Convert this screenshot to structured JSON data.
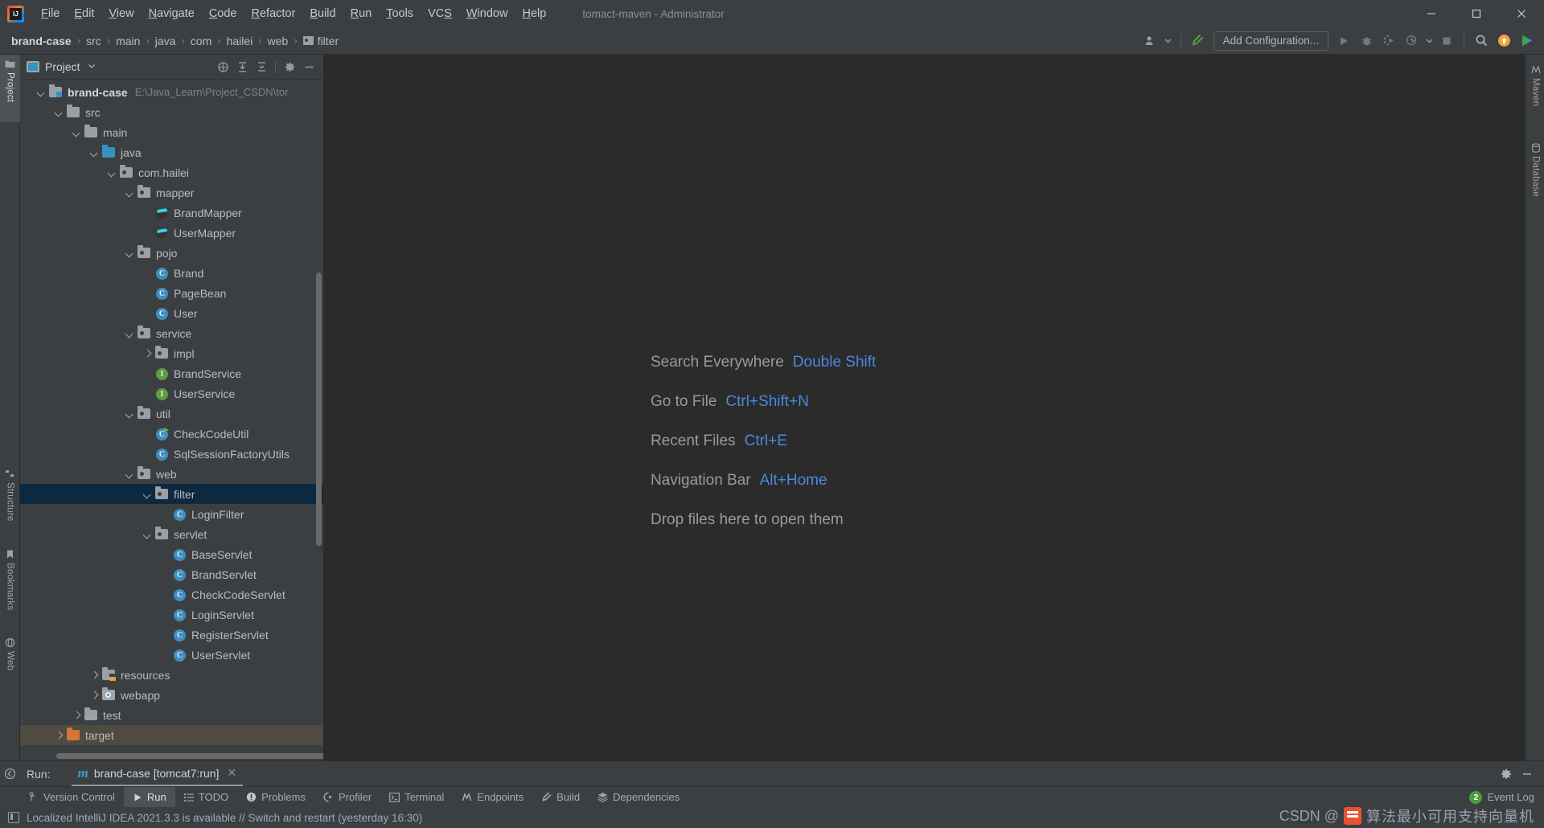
{
  "window": {
    "title": "tomact-maven - Administrator",
    "app_icon": "intellij-idea-logo",
    "controls": {
      "minimize": "─",
      "maximize": "❑",
      "close": "✕"
    }
  },
  "menubar": {
    "items": [
      {
        "label": "File",
        "mnemonic": "F"
      },
      {
        "label": "Edit",
        "mnemonic": "E"
      },
      {
        "label": "View",
        "mnemonic": "V"
      },
      {
        "label": "Navigate",
        "mnemonic": "N"
      },
      {
        "label": "Code",
        "mnemonic": "C"
      },
      {
        "label": "Refactor",
        "mnemonic": "R"
      },
      {
        "label": "Build",
        "mnemonic": "B"
      },
      {
        "label": "Run",
        "mnemonic": "R"
      },
      {
        "label": "Tools",
        "mnemonic": "T"
      },
      {
        "label": "VCS",
        "mnemonic": "S"
      },
      {
        "label": "Window",
        "mnemonic": "W"
      },
      {
        "label": "Help",
        "mnemonic": "H"
      }
    ]
  },
  "navbar": {
    "breadcrumb": [
      {
        "label": "brand-case",
        "icon": ""
      },
      {
        "label": "src",
        "icon": ""
      },
      {
        "label": "main",
        "icon": ""
      },
      {
        "label": "java",
        "icon": ""
      },
      {
        "label": "com",
        "icon": ""
      },
      {
        "label": "hailei",
        "icon": ""
      },
      {
        "label": "web",
        "icon": ""
      },
      {
        "label": "filter",
        "icon": "package-folder-icon"
      }
    ],
    "separator": "›",
    "run_config_button": "Add Configuration...",
    "icons": [
      "user-settings-icon",
      "chevron-down-icon",
      "hammer-build-icon",
      "run-icon",
      "debug-icon",
      "run-with-coverage-icon",
      "profile-icon",
      "chevron-down-icon",
      "stop-icon",
      "search-icon",
      "update-available-icon",
      "ide-features-trainer-icon"
    ]
  },
  "left_tool_strip": {
    "tabs": [
      {
        "label": "Project",
        "icon": "project-folder-icon",
        "active": true
      },
      {
        "label": "Structure",
        "icon": "structure-icon",
        "active": false
      },
      {
        "label": "Bookmarks",
        "icon": "bookmark-icon",
        "active": false
      },
      {
        "label": "Web",
        "icon": "web-globe-icon",
        "active": false
      }
    ]
  },
  "project_panel": {
    "title": "Project",
    "header_icons": [
      "scroll-from-source-icon",
      "expand-all-icon",
      "collapse-all-icon",
      "settings-gear-icon",
      "hide-icon"
    ],
    "tree": [
      {
        "depth": 0,
        "label": "brand-case",
        "hint": "E:\\Java_Learn\\Project_CSDN\\tor",
        "icon": "module-folder-icon",
        "arrow": "down",
        "bold": true,
        "state": ""
      },
      {
        "depth": 1,
        "label": "src",
        "hint": "",
        "icon": "folder-icon",
        "arrow": "down",
        "bold": false,
        "state": ""
      },
      {
        "depth": 2,
        "label": "main",
        "hint": "",
        "icon": "folder-icon",
        "arrow": "down",
        "bold": false,
        "state": ""
      },
      {
        "depth": 3,
        "label": "java",
        "hint": "",
        "icon": "source-root-folder-icon",
        "arrow": "down",
        "bold": false,
        "state": ""
      },
      {
        "depth": 4,
        "label": "com.hailei",
        "hint": "",
        "icon": "package-icon",
        "arrow": "down",
        "bold": false,
        "state": ""
      },
      {
        "depth": 5,
        "label": "mapper",
        "hint": "",
        "icon": "package-icon",
        "arrow": "down",
        "bold": false,
        "state": ""
      },
      {
        "depth": 6,
        "label": "BrandMapper",
        "hint": "",
        "icon": "mybatis-mapper-icon",
        "arrow": "none",
        "bold": false,
        "state": ""
      },
      {
        "depth": 6,
        "label": "UserMapper",
        "hint": "",
        "icon": "mybatis-mapper-icon",
        "arrow": "none",
        "bold": false,
        "state": ""
      },
      {
        "depth": 5,
        "label": "pojo",
        "hint": "",
        "icon": "package-icon",
        "arrow": "down",
        "bold": false,
        "state": ""
      },
      {
        "depth": 6,
        "label": "Brand",
        "hint": "",
        "icon": "java-class-icon",
        "arrow": "none",
        "bold": false,
        "state": ""
      },
      {
        "depth": 6,
        "label": "PageBean",
        "hint": "",
        "icon": "java-class-icon",
        "arrow": "none",
        "bold": false,
        "state": ""
      },
      {
        "depth": 6,
        "label": "User",
        "hint": "",
        "icon": "java-class-icon",
        "arrow": "none",
        "bold": false,
        "state": ""
      },
      {
        "depth": 5,
        "label": "service",
        "hint": "",
        "icon": "package-icon",
        "arrow": "down",
        "bold": false,
        "state": ""
      },
      {
        "depth": 6,
        "label": "impl",
        "hint": "",
        "icon": "package-icon",
        "arrow": "right",
        "bold": false,
        "state": ""
      },
      {
        "depth": 6,
        "label": "BrandService",
        "hint": "",
        "icon": "java-interface-icon",
        "arrow": "none",
        "bold": false,
        "state": ""
      },
      {
        "depth": 6,
        "label": "UserService",
        "hint": "",
        "icon": "java-interface-icon",
        "arrow": "none",
        "bold": false,
        "state": ""
      },
      {
        "depth": 5,
        "label": "util",
        "hint": "",
        "icon": "package-icon",
        "arrow": "down",
        "bold": false,
        "state": ""
      },
      {
        "depth": 6,
        "label": "CheckCodeUtil",
        "hint": "",
        "icon": "java-class-runnable-icon",
        "arrow": "none",
        "bold": false,
        "state": ""
      },
      {
        "depth": 6,
        "label": "SqlSessionFactoryUtils",
        "hint": "",
        "icon": "java-class-icon",
        "arrow": "none",
        "bold": false,
        "state": ""
      },
      {
        "depth": 5,
        "label": "web",
        "hint": "",
        "icon": "package-icon",
        "arrow": "down",
        "bold": false,
        "state": ""
      },
      {
        "depth": 6,
        "label": "filter",
        "hint": "",
        "icon": "package-icon",
        "arrow": "down",
        "bold": false,
        "state": "selected"
      },
      {
        "depth": 7,
        "label": "LoginFilter",
        "hint": "",
        "icon": "java-class-icon",
        "arrow": "none",
        "bold": false,
        "state": ""
      },
      {
        "depth": 6,
        "label": "servlet",
        "hint": "",
        "icon": "package-icon",
        "arrow": "down",
        "bold": false,
        "state": ""
      },
      {
        "depth": 7,
        "label": "BaseServlet",
        "hint": "",
        "icon": "java-class-icon",
        "arrow": "none",
        "bold": false,
        "state": ""
      },
      {
        "depth": 7,
        "label": "BrandServlet",
        "hint": "",
        "icon": "java-class-icon",
        "arrow": "none",
        "bold": false,
        "state": ""
      },
      {
        "depth": 7,
        "label": "CheckCodeServlet",
        "hint": "",
        "icon": "java-class-icon",
        "arrow": "none",
        "bold": false,
        "state": ""
      },
      {
        "depth": 7,
        "label": "LoginServlet",
        "hint": "",
        "icon": "java-class-icon",
        "arrow": "none",
        "bold": false,
        "state": ""
      },
      {
        "depth": 7,
        "label": "RegisterServlet",
        "hint": "",
        "icon": "java-class-icon",
        "arrow": "none",
        "bold": false,
        "state": ""
      },
      {
        "depth": 7,
        "label": "UserServlet",
        "hint": "",
        "icon": "java-class-icon",
        "arrow": "none",
        "bold": false,
        "state": ""
      },
      {
        "depth": 3,
        "label": "resources",
        "hint": "",
        "icon": "resources-folder-icon",
        "arrow": "right",
        "bold": false,
        "state": ""
      },
      {
        "depth": 3,
        "label": "webapp",
        "hint": "",
        "icon": "webapp-folder-icon",
        "arrow": "right",
        "bold": false,
        "state": ""
      },
      {
        "depth": 2,
        "label": "test",
        "hint": "",
        "icon": "folder-icon",
        "arrow": "right",
        "bold": false,
        "state": ""
      },
      {
        "depth": 1,
        "label": "target",
        "hint": "",
        "icon": "excluded-folder-icon",
        "arrow": "right",
        "bold": false,
        "state": "highlight-target"
      }
    ]
  },
  "editor": {
    "hints": [
      {
        "label": "Search Everywhere",
        "key": "Double Shift"
      },
      {
        "label": "Go to File",
        "key": "Ctrl+Shift+N"
      },
      {
        "label": "Recent Files",
        "key": "Ctrl+E"
      },
      {
        "label": "Navigation Bar",
        "key": "Alt+Home"
      },
      {
        "label": "Drop files here to open them",
        "key": ""
      }
    ]
  },
  "right_tool_strip": {
    "tabs": [
      {
        "label": "Maven",
        "icon": "maven-icon"
      },
      {
        "label": "Database",
        "icon": "database-icon"
      }
    ]
  },
  "run_toolwindow": {
    "hide_icon": "hide-toolwindow-icon",
    "label": "Run:",
    "tab": {
      "icon": "maven-m-icon",
      "label": "brand-case [tomcat7:run]",
      "close": "✕"
    },
    "header_icons": [
      "settings-gear-icon",
      "hide-icon"
    ]
  },
  "bottom_bar": {
    "tabs": [
      {
        "label": "Version Control",
        "icon": "branch-icon",
        "active": false
      },
      {
        "label": "Run",
        "icon": "run-icon",
        "active": true
      },
      {
        "label": "TODO",
        "icon": "list-icon",
        "active": false
      },
      {
        "label": "Problems",
        "icon": "warning-icon",
        "active": false
      },
      {
        "label": "Profiler",
        "icon": "profiler-icon",
        "active": false
      },
      {
        "label": "Terminal",
        "icon": "terminal-icon",
        "active": false
      },
      {
        "label": "Endpoints",
        "icon": "endpoints-icon",
        "active": false
      },
      {
        "label": "Build",
        "icon": "hammer-build-icon",
        "active": false
      },
      {
        "label": "Dependencies",
        "icon": "layers-icon",
        "active": false
      }
    ],
    "event_log": {
      "label": "Event Log",
      "badge": "2"
    }
  },
  "status_bar": {
    "icon": "notification-icon",
    "message": "Localized IntelliJ IDEA 2021.3.3 is available // Switch and restart (yesterday 16:30)"
  },
  "watermark": {
    "prefix": "CSDN @",
    "text": "算法最小可用支持向量机"
  },
  "colors": {
    "background": "#3c3f41",
    "editor_background": "#2b2b2b",
    "accent_link": "#4a88e0",
    "selection": "#0d293f",
    "class_icon": "#3e8fbf",
    "interface_icon": "#5a9e3f",
    "target_folder": "#d4753a",
    "badge_green": "#4a9e3c"
  }
}
